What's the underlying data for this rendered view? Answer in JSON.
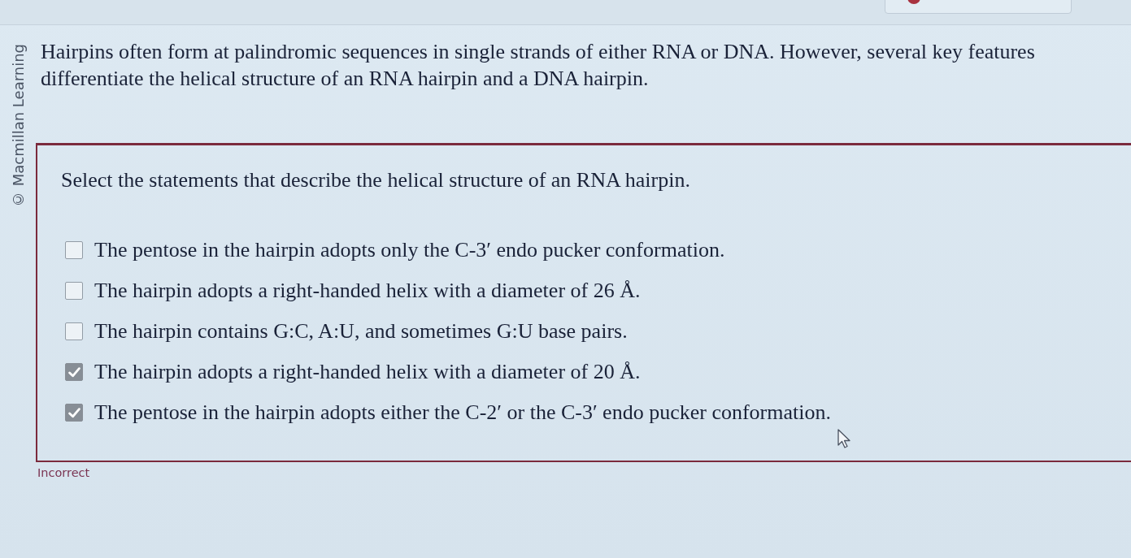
{
  "copyright": "© Macmillan Learning",
  "intro": "Hairpins often form at palindromic sequences in single strands of either RNA or DNA. However, several key features differentiate the helical structure of an RNA hairpin and a DNA hairpin.",
  "question": {
    "prompt": "Select the statements that describe the helical structure of an RNA hairpin.",
    "options": [
      {
        "label": "The pentose in the hairpin adopts only the C-3′ endo pucker conformation.",
        "checked": false
      },
      {
        "label": "The hairpin adopts a right-handed helix with a diameter of 26 Å.",
        "checked": false
      },
      {
        "label": "The hairpin contains G:C, A:U, and sometimes G:U base pairs.",
        "checked": false
      },
      {
        "label": "The hairpin adopts a right-handed helix with a diameter of 20 Å.",
        "checked": true
      },
      {
        "label": "The pentose in the hairpin adopts either the C-2′ or the C-3′ endo pucker conformation.",
        "checked": true
      }
    ]
  },
  "feedback": "Incorrect"
}
